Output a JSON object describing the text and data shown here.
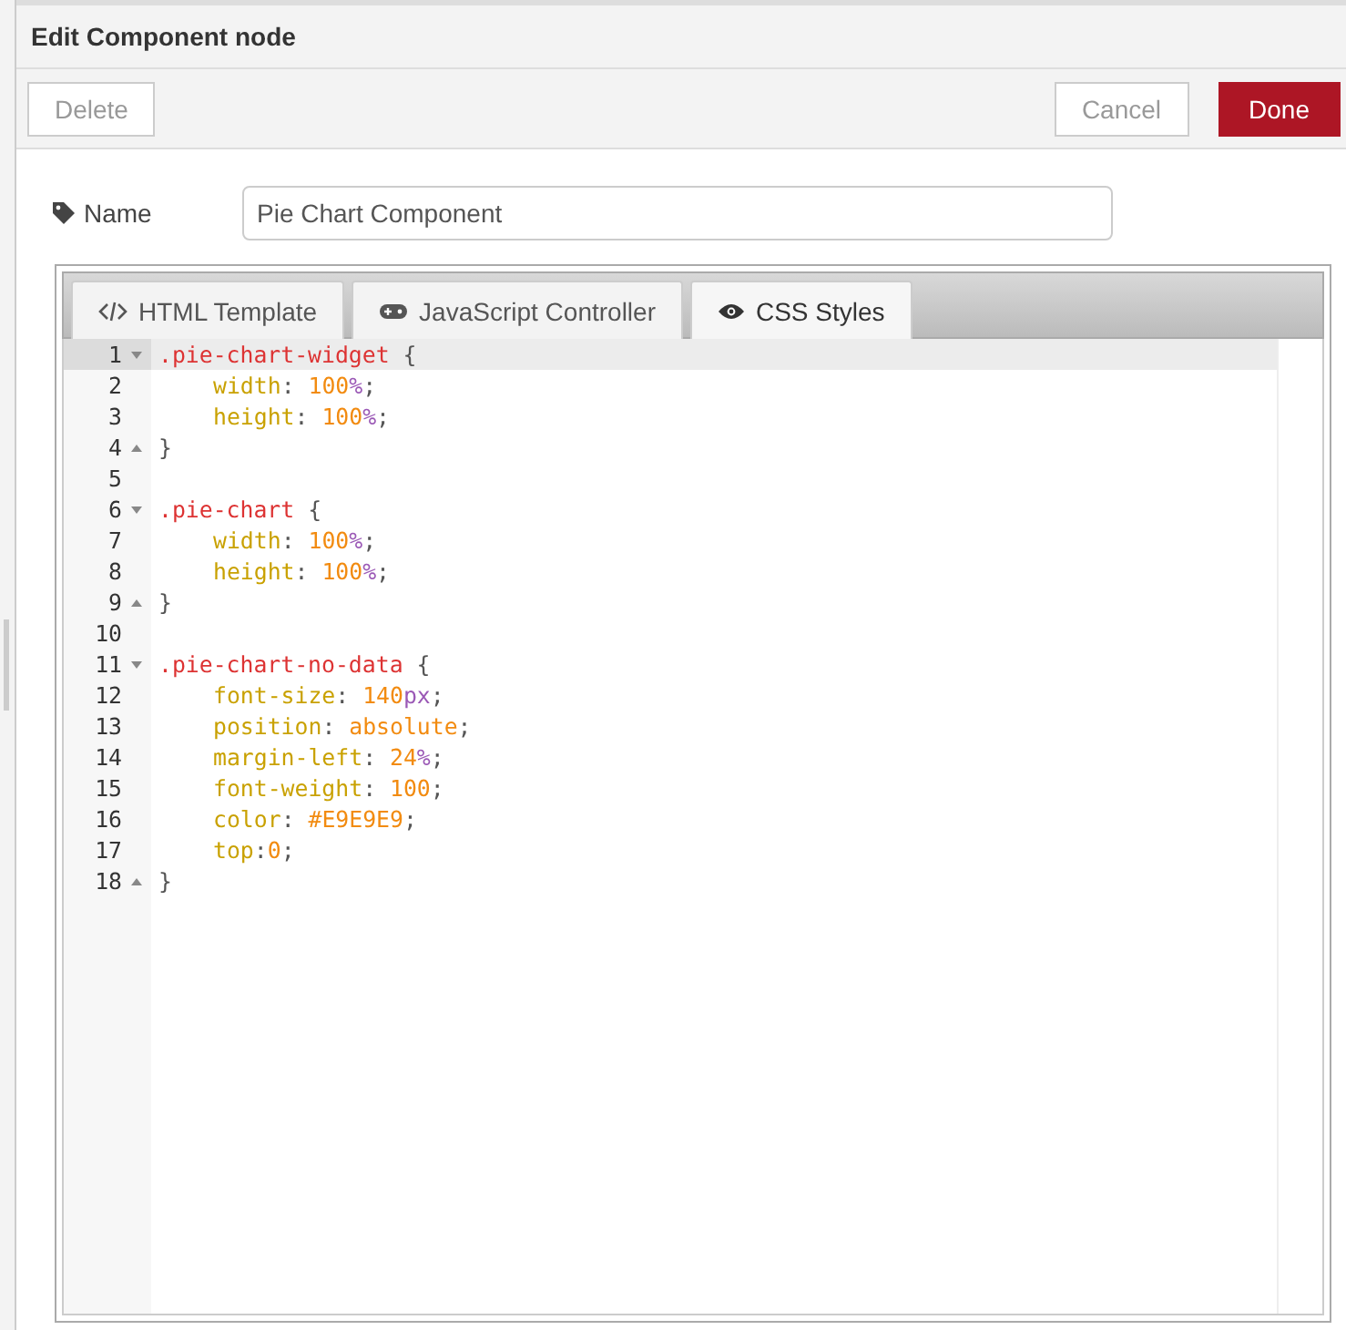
{
  "dialog": {
    "title": "Edit Component node"
  },
  "buttons": [
    {
      "label": "Delete",
      "kind": "plain"
    },
    {
      "label": "Cancel",
      "kind": "plain"
    },
    {
      "label": "Done",
      "kind": "primary"
    }
  ],
  "name_field": {
    "label": "Name",
    "value": "Pie Chart Component"
  },
  "tabs": [
    {
      "label": "HTML Template",
      "selected": false
    },
    {
      "label": "JavaScript Controller",
      "selected": false
    },
    {
      "label": "CSS Styles",
      "selected": true
    }
  ],
  "editor": {
    "lines": [
      {
        "number": "1",
        "kind": "open",
        "active": true,
        "tokens": [
          {
            "kind": "selector",
            "text": ".pie-chart-widget"
          },
          {
            "kind": "punct",
            "text": " {"
          }
        ]
      },
      {
        "number": "2",
        "kind": "decl",
        "active": false,
        "tokens": [
          {
            "kind": "property",
            "text": "width"
          },
          {
            "kind": "punct",
            "text": ": "
          },
          {
            "kind": "number",
            "text": "100"
          },
          {
            "kind": "unit",
            "text": "%"
          },
          {
            "kind": "punct",
            "text": ";"
          }
        ]
      },
      {
        "number": "3",
        "kind": "decl",
        "active": false,
        "tokens": [
          {
            "kind": "property",
            "text": "height"
          },
          {
            "kind": "punct",
            "text": ": "
          },
          {
            "kind": "number",
            "text": "100"
          },
          {
            "kind": "unit",
            "text": "%"
          },
          {
            "kind": "punct",
            "text": ";"
          }
        ]
      },
      {
        "number": "4",
        "kind": "close",
        "active": false,
        "tokens": [
          {
            "kind": "punct",
            "text": "}"
          }
        ]
      },
      {
        "number": "5",
        "kind": "blank",
        "active": false
      },
      {
        "number": "6",
        "kind": "open",
        "active": false,
        "tokens": [
          {
            "kind": "selector",
            "text": ".pie-chart"
          },
          {
            "kind": "punct",
            "text": " {"
          }
        ]
      },
      {
        "number": "7",
        "kind": "decl",
        "active": false,
        "tokens": [
          {
            "kind": "property",
            "text": "width"
          },
          {
            "kind": "punct",
            "text": ": "
          },
          {
            "kind": "number",
            "text": "100"
          },
          {
            "kind": "unit",
            "text": "%"
          },
          {
            "kind": "punct",
            "text": ";"
          }
        ]
      },
      {
        "number": "8",
        "kind": "decl",
        "active": false,
        "tokens": [
          {
            "kind": "property",
            "text": "height"
          },
          {
            "kind": "punct",
            "text": ": "
          },
          {
            "kind": "number",
            "text": "100"
          },
          {
            "kind": "unit",
            "text": "%"
          },
          {
            "kind": "punct",
            "text": ";"
          }
        ]
      },
      {
        "number": "9",
        "kind": "close",
        "active": false,
        "tokens": [
          {
            "kind": "punct",
            "text": "}"
          }
        ]
      },
      {
        "number": "10",
        "kind": "blank",
        "active": false
      },
      {
        "number": "11",
        "kind": "open",
        "active": false,
        "tokens": [
          {
            "kind": "selector",
            "text": ".pie-chart-no-data"
          },
          {
            "kind": "punct",
            "text": " {"
          }
        ]
      },
      {
        "number": "12",
        "kind": "decl",
        "active": false,
        "tokens": [
          {
            "kind": "property",
            "text": "font-size"
          },
          {
            "kind": "punct",
            "text": ": "
          },
          {
            "kind": "number",
            "text": "140"
          },
          {
            "kind": "unit",
            "text": "px"
          },
          {
            "kind": "punct",
            "text": ";"
          }
        ]
      },
      {
        "number": "13",
        "kind": "decl",
        "active": false,
        "tokens": [
          {
            "kind": "property",
            "text": "position"
          },
          {
            "kind": "punct",
            "text": ": "
          },
          {
            "kind": "number",
            "text": "absolute"
          },
          {
            "kind": "punct",
            "text": ";"
          }
        ]
      },
      {
        "number": "14",
        "kind": "decl",
        "active": false,
        "tokens": [
          {
            "kind": "property",
            "text": "margin-left"
          },
          {
            "kind": "punct",
            "text": ": "
          },
          {
            "kind": "number",
            "text": "24"
          },
          {
            "kind": "unit",
            "text": "%"
          },
          {
            "kind": "punct",
            "text": ";"
          }
        ]
      },
      {
        "number": "15",
        "kind": "decl",
        "active": false,
        "tokens": [
          {
            "kind": "property",
            "text": "font-weight"
          },
          {
            "kind": "punct",
            "text": ": "
          },
          {
            "kind": "number",
            "text": "100"
          },
          {
            "kind": "punct",
            "text": ";"
          }
        ]
      },
      {
        "number": "16",
        "kind": "decl",
        "active": false,
        "tokens": [
          {
            "kind": "property",
            "text": "color"
          },
          {
            "kind": "punct",
            "text": ": "
          },
          {
            "kind": "number",
            "text": "#E9E9E9"
          },
          {
            "kind": "punct",
            "text": ";"
          }
        ]
      },
      {
        "number": "17",
        "kind": "decl",
        "active": false,
        "tokens": [
          {
            "kind": "property",
            "text": "top"
          },
          {
            "kind": "punct",
            "text": ":"
          },
          {
            "kind": "number",
            "text": "0"
          },
          {
            "kind": "punct",
            "text": ";"
          }
        ]
      },
      {
        "number": "18",
        "kind": "close",
        "active": false,
        "tokens": [
          {
            "kind": "punct",
            "text": "}"
          }
        ]
      }
    ]
  }
}
